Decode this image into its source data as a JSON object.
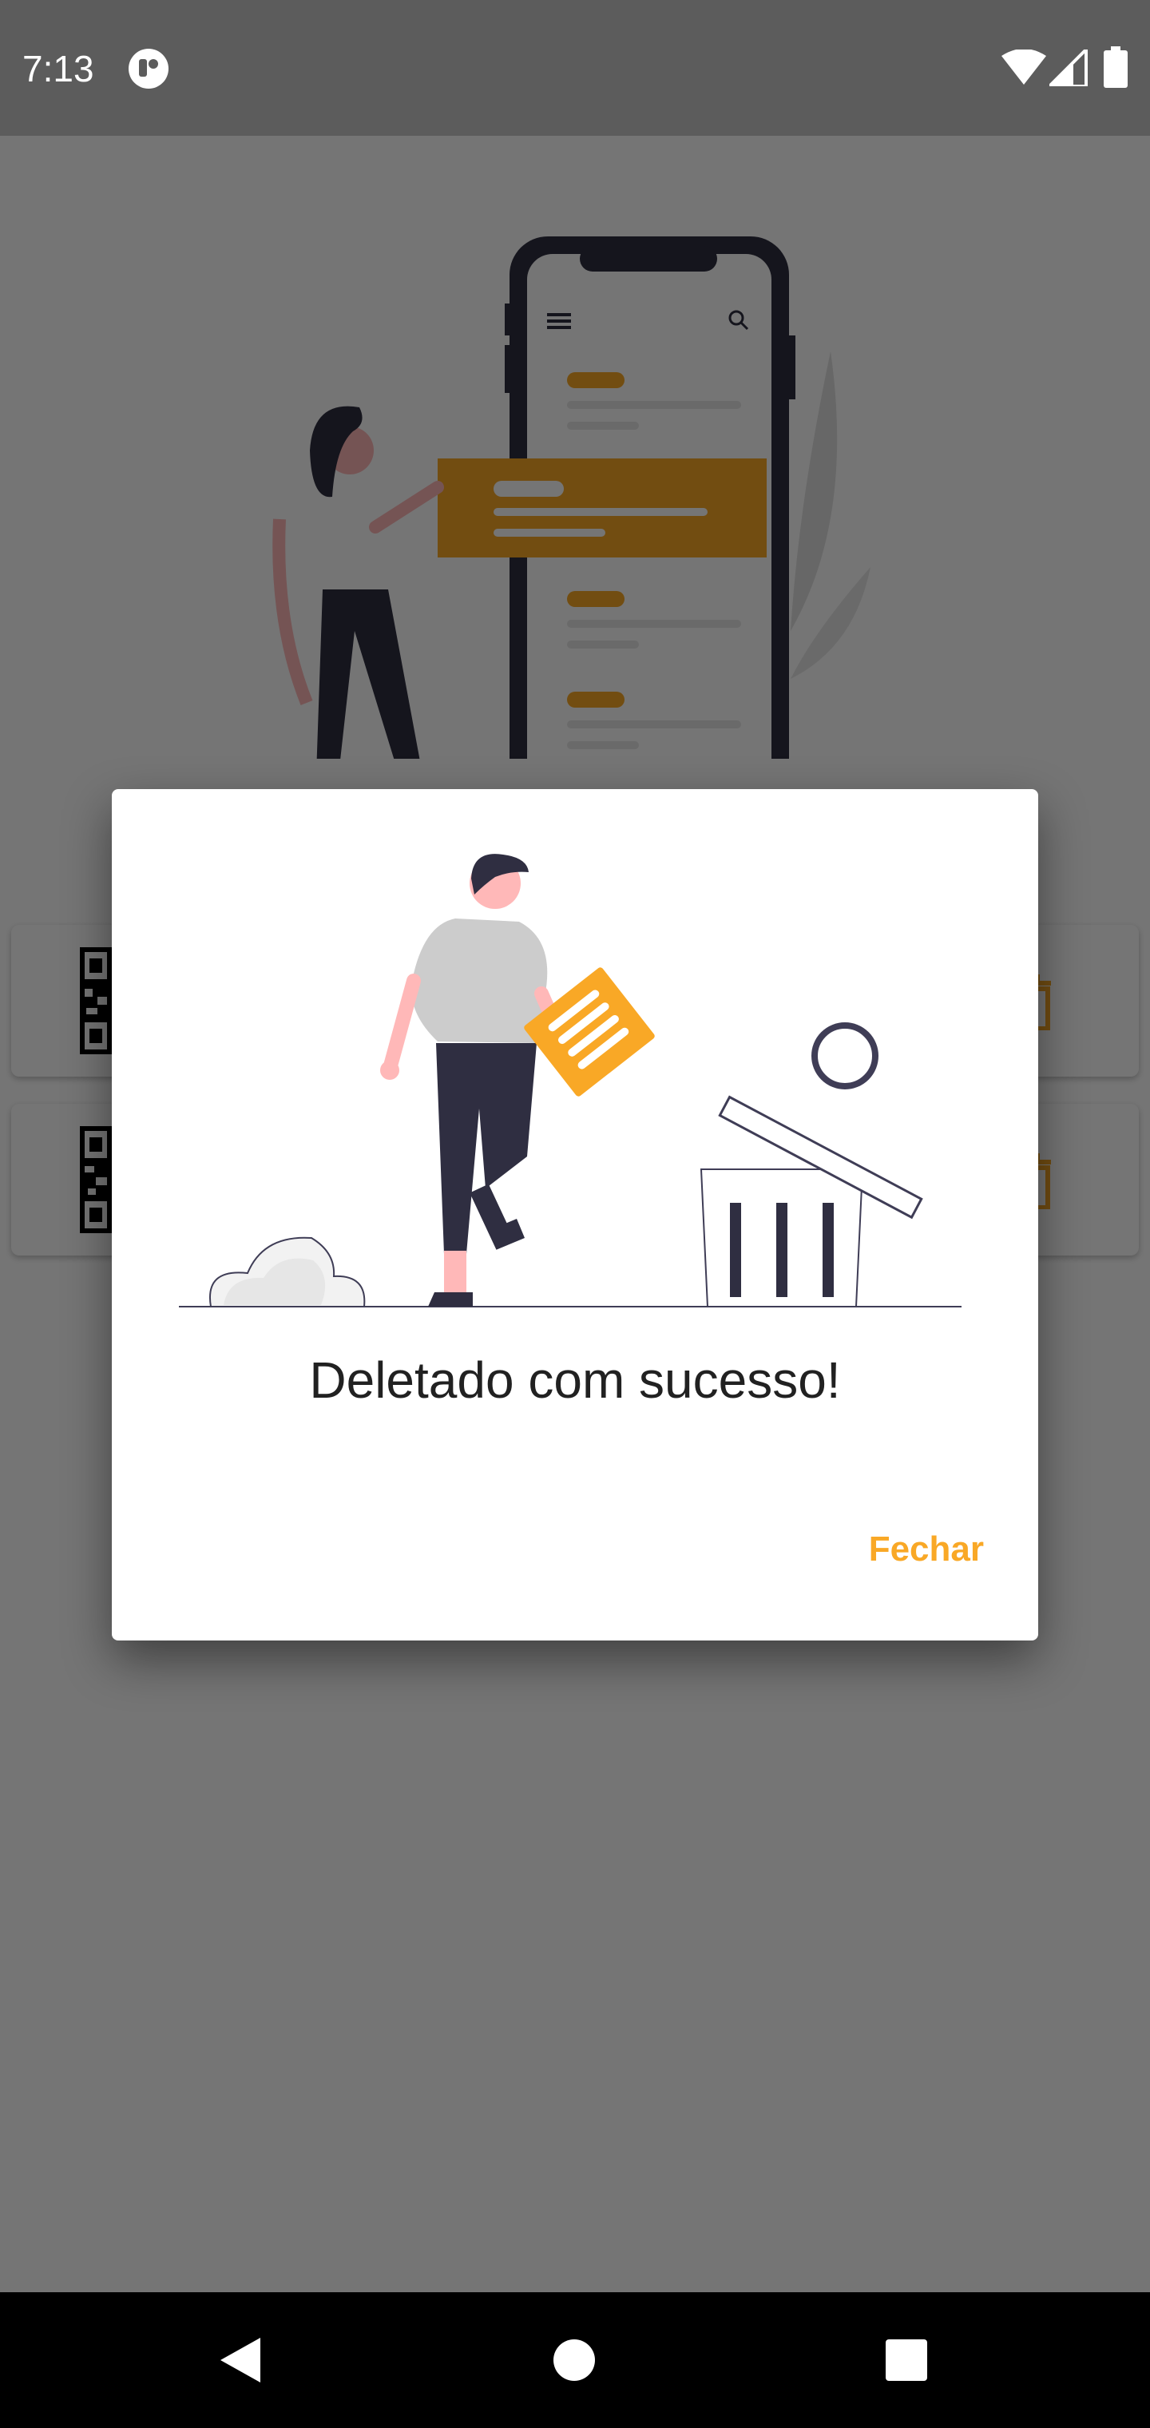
{
  "status_bar": {
    "time": "7:13",
    "icons": [
      "app-notification-icon",
      "wifi-icon",
      "cell-signal-icon",
      "battery-icon"
    ]
  },
  "app": {
    "cards": [
      {
        "leading_icon": "qr-code-icon",
        "trailing_icon": "trash-icon"
      },
      {
        "leading_icon": "qr-code-icon",
        "trailing_icon": "trash-icon"
      }
    ]
  },
  "dialog": {
    "title": "Deletado com sucesso!",
    "close_label": "Fechar"
  },
  "nav_bar": {
    "icons": [
      "back-icon",
      "home-icon",
      "recents-icon"
    ]
  },
  "colors": {
    "accent": "#F9A826",
    "dark_figure": "#2F2E41",
    "status_bar": "#5C5C5C",
    "scrim": "rgba(0,0,0,0.54)",
    "dialog_bg": "#FFFFFF",
    "title_text": "#212121"
  }
}
